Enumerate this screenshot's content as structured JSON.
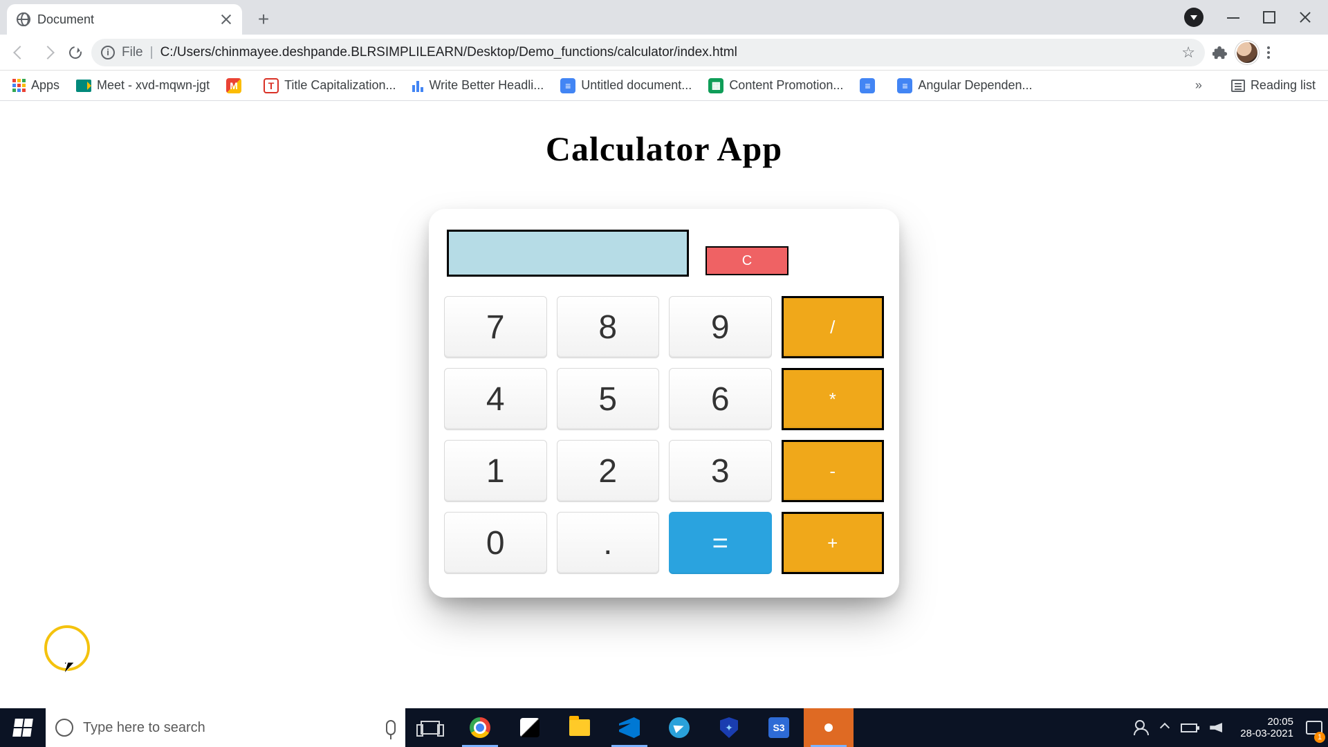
{
  "browser": {
    "tab_title": "Document",
    "omnibox_scheme": "File",
    "omnibox_path": "C:/Users/chinmayee.deshpande.BLRSIMPLILEARN/Desktop/Demo_functions/calculator/index.html"
  },
  "bookmarks": {
    "apps": "Apps",
    "items": [
      "Meet - xvd-mqwn-jgt",
      "",
      "Title Capitalization...",
      "Write Better Headli...",
      "Untitled document...",
      "Content Promotion...",
      "",
      "Angular Dependen..."
    ],
    "overflow": "»",
    "reading_list": "Reading list"
  },
  "page": {
    "heading": "Calculator App",
    "display_value": "",
    "clear_label": "C",
    "keys": {
      "r1": [
        "7",
        "8",
        "9",
        "/"
      ],
      "r2": [
        "4",
        "5",
        "6",
        "*"
      ],
      "r3": [
        "1",
        "2",
        "3",
        "-"
      ],
      "r4": [
        "0",
        ".",
        "=",
        "+"
      ]
    }
  },
  "taskbar": {
    "search_placeholder": "Type here to search",
    "clock_time": "20:05",
    "clock_date": "28-03-2021",
    "notif_count": "1",
    "s3_label": "S3"
  }
}
